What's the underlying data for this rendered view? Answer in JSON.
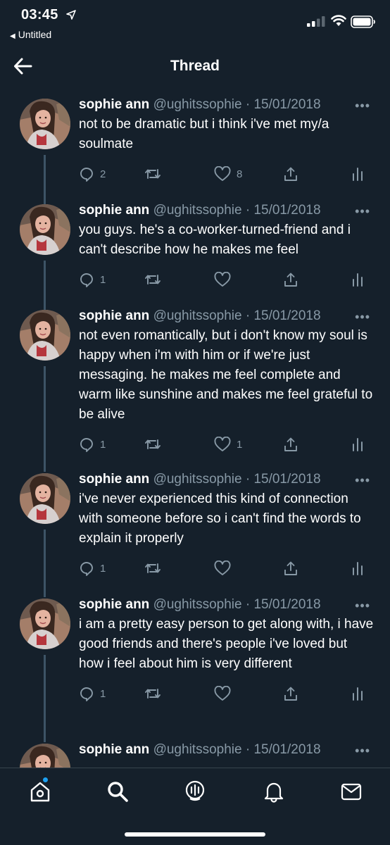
{
  "status_bar": {
    "time": "03:45",
    "back_app": "Untitled"
  },
  "header": {
    "title": "Thread"
  },
  "tweets": [
    {
      "name": "sophie ann",
      "handle": "@ughitssophie",
      "date": "15/01/2018",
      "text": "not to be dramatic but i think i've met my/a soulmate",
      "replies": "2",
      "retweets": "",
      "likes": "8"
    },
    {
      "name": "sophie ann",
      "handle": "@ughitssophie",
      "date": "15/01/2018",
      "text": "you guys. he's a co-worker-turned-friend and i can't describe how he makes me feel",
      "replies": "1",
      "retweets": "",
      "likes": ""
    },
    {
      "name": "sophie ann",
      "handle": "@ughitssophie",
      "date": "15/01/2018",
      "text": "not even romantically, but i don't know my soul is happy when i'm with him or if we're just messaging. he makes me feel complete and warm like sunshine and makes me feel grateful to be alive",
      "replies": "1",
      "retweets": "",
      "likes": "1"
    },
    {
      "name": "sophie ann",
      "handle": "@ughitssophie",
      "date": "15/01/2018",
      "text": "i've never experienced this kind of connection with someone before so i can't find the words to explain it properly",
      "replies": "1",
      "retweets": "",
      "likes": ""
    },
    {
      "name": "sophie ann",
      "handle": "@ughitssophie",
      "date": "15/01/2018",
      "text": "i am a pretty easy person to get along with, i have good friends and there's people i've loved but how i feel about him is very different",
      "replies": "1",
      "retweets": "",
      "likes": ""
    },
    {
      "name": "sophie ann",
      "handle": "@ughitssophie",
      "date": "15/01/2018",
      "text": "",
      "replies": "",
      "retweets": "",
      "likes": ""
    }
  ],
  "tabs": [
    "home-icon",
    "search-icon",
    "spaces-icon",
    "notifications-icon",
    "messages-icon"
  ],
  "colors": {
    "background": "#15202b",
    "secondary_text": "#8899a6",
    "accent": "#1da1f2",
    "thread_line": "#3d5466"
  }
}
